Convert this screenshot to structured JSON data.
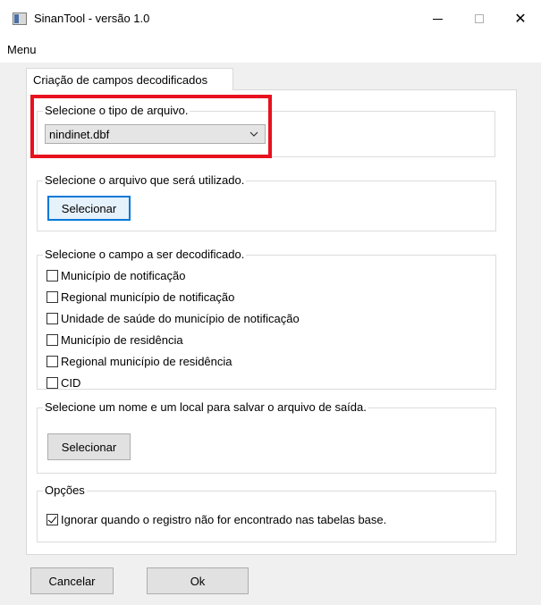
{
  "window": {
    "title": "SinanTool - versão 1.0",
    "minimize_label": "",
    "close_label": "✕"
  },
  "menu": {
    "items": [
      {
        "label": "Menu"
      }
    ]
  },
  "tab": {
    "label": "Criação de campos decodificados"
  },
  "file_type": {
    "legend": "Selecione o tipo de arquivo.",
    "selected": "nindinet.dbf"
  },
  "input_file": {
    "legend": "Selecione o arquivo que será utilizado.",
    "button_label": "Selecionar"
  },
  "fields": {
    "legend": "Selecione o campo a ser decodificado.",
    "items": [
      {
        "label": "Município de notificação",
        "checked": false
      },
      {
        "label": "Regional município de notificação",
        "checked": false
      },
      {
        "label": "Unidade de saúde do município de notificação",
        "checked": false
      },
      {
        "label": "Município de residência",
        "checked": false
      },
      {
        "label": "Regional município de residência",
        "checked": false
      },
      {
        "label": "CID",
        "checked": false
      }
    ]
  },
  "output_file": {
    "legend": "Selecione um nome e um local para salvar o arquivo de saída.",
    "button_label": "Selecionar"
  },
  "options": {
    "legend": "Opções",
    "ignore_missing": {
      "label": "Ignorar quando o registro não for encontrado nas tabelas base.",
      "checked": true
    }
  },
  "footer": {
    "cancel_label": "Cancelar",
    "ok_label": "Ok"
  },
  "colors": {
    "highlight": "#e8111e",
    "focus": "#0078d7"
  },
  "icons": {
    "app": "app-icon",
    "minimize": "minimize-icon",
    "maximize": "maximize-icon",
    "close": "close-icon",
    "dropdown": "chevron-down-icon",
    "checkmark": "checkmark-icon"
  }
}
